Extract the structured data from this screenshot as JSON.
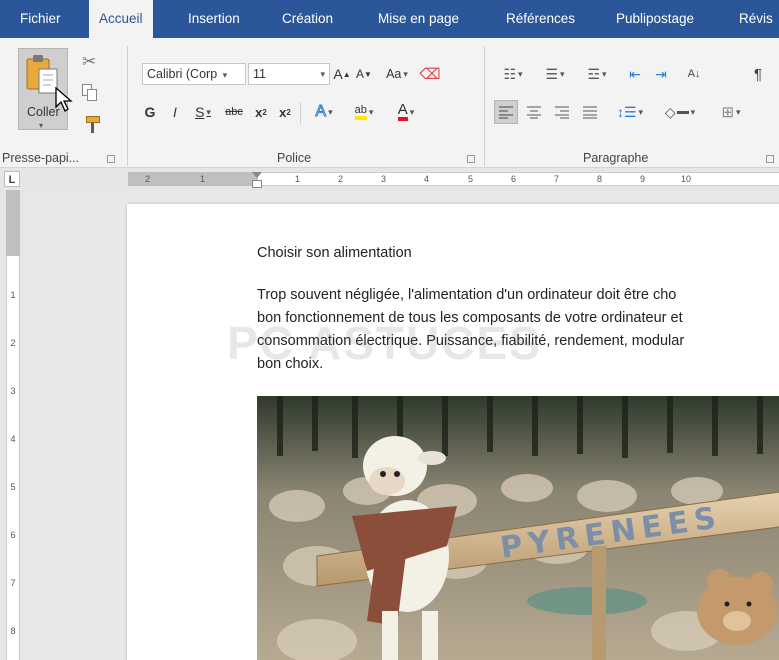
{
  "tabs": [
    {
      "label": "Fichier"
    },
    {
      "label": "Accueil",
      "active": true
    },
    {
      "label": "Insertion"
    },
    {
      "label": "Création"
    },
    {
      "label": "Mise en page"
    },
    {
      "label": "Références"
    },
    {
      "label": "Publipostage"
    },
    {
      "label": "Révis"
    }
  ],
  "clipboard": {
    "paste_label": "Coller",
    "group_label": "Presse-papi..."
  },
  "font": {
    "name": "Calibri (Corp",
    "size": "11",
    "bold": "G",
    "italic": "I",
    "underline": "S",
    "strike": "abc",
    "subscript": "x",
    "superscript": "x",
    "case": "Aa",
    "grow": "A",
    "shrink": "A",
    "effects": "A",
    "highlight": "ab",
    "color_glyph": "A",
    "group_label": "Police"
  },
  "paragraph": {
    "group_label": "Paragraphe",
    "sort_glyph": "A↓",
    "marks_glyph": "¶"
  },
  "ruler": {
    "h_numbers": [
      "2",
      "1",
      "1",
      "2",
      "3",
      "4",
      "5",
      "6",
      "7",
      "8",
      "9",
      "10"
    ],
    "v_numbers": [
      "1",
      "2",
      "3",
      "4",
      "5",
      "6",
      "7",
      "8"
    ],
    "tab_selector": "L"
  },
  "document": {
    "title": "Choisir son alimentation",
    "lines": [
      "Trop souvent négligée, l'alimentation d'un ordinateur doit être cho",
      "bon fonctionnement de tous les composants de votre ordinateur et",
      "consommation électrique. Puissance, fiabilité, rendement, modular",
      "bon choix."
    ],
    "watermark": "PC ASTUCES",
    "photo_sign": "PYRENEES"
  },
  "colors": {
    "tab_bar": "#2b579a",
    "ribbon": "#f3f3f3",
    "highlight": "#ffe400",
    "font_color": "#e81123"
  }
}
